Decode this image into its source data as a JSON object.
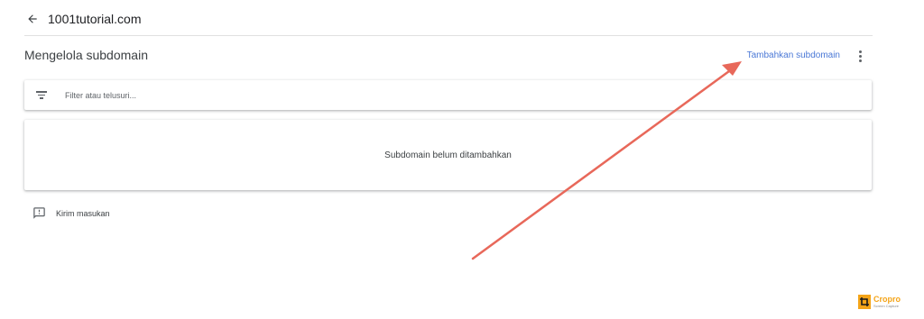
{
  "header": {
    "title": "1001tutorial.com",
    "back_icon": "arrow-back-icon"
  },
  "page": {
    "title": "Mengelola subdomain",
    "add_label": "Tambahkan subdomain",
    "more_icon": "more-vert-icon"
  },
  "filter": {
    "placeholder": "Filter atau telusuri...",
    "value": "",
    "icon": "filter-list-icon"
  },
  "empty_state": {
    "message": "Subdomain belum ditambahkan"
  },
  "feedback": {
    "label": "Kirim masukan",
    "icon": "feedback-icon"
  },
  "colors": {
    "accent": "#4a78d6",
    "annotation_arrow": "#e8685a",
    "watermark": "#f4a418"
  },
  "watermark": {
    "name": "Cropro",
    "subtitle": "Screen Capture"
  }
}
